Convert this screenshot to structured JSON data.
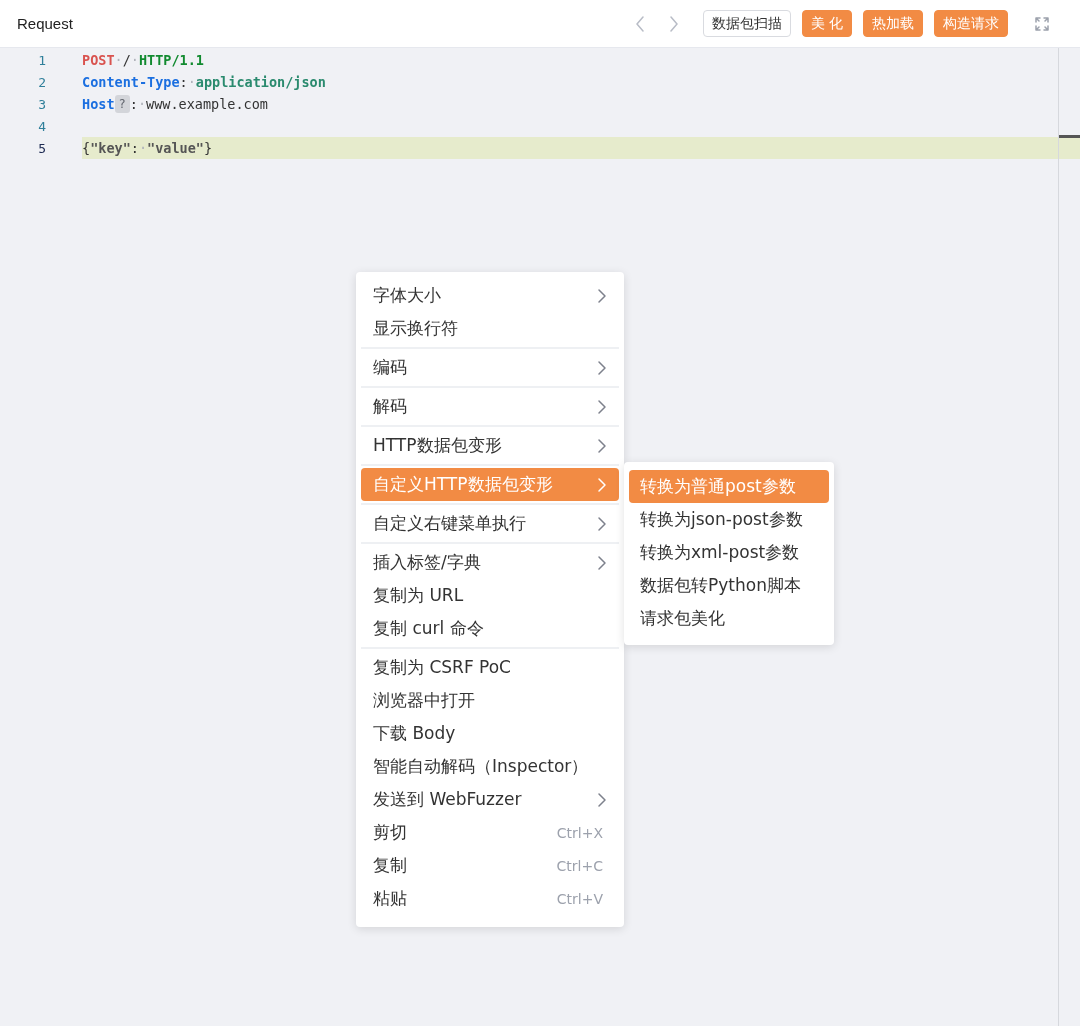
{
  "header": {
    "title": "Request",
    "buttons": [
      {
        "label": "数据包扫描",
        "kind": "outline"
      },
      {
        "label": "美 化",
        "kind": "primary"
      },
      {
        "label": "热加载",
        "kind": "primary"
      },
      {
        "label": "构造请求",
        "kind": "primary"
      }
    ]
  },
  "editor": {
    "lines": [
      {
        "number": "1",
        "active": false,
        "tokens": [
          {
            "kind": "method",
            "text": "POST"
          },
          {
            "kind": "space",
            "text": "·"
          },
          {
            "kind": "plain",
            "text": "/"
          },
          {
            "kind": "space",
            "text": "·"
          },
          {
            "kind": "version",
            "text": "HTTP/1.1"
          }
        ]
      },
      {
        "number": "2",
        "active": false,
        "tokens": [
          {
            "kind": "key",
            "text": "Content-Type"
          },
          {
            "kind": "plain",
            "text": ":"
          },
          {
            "kind": "space",
            "text": "·"
          },
          {
            "kind": "value",
            "text": "application/json"
          }
        ]
      },
      {
        "number": "3",
        "active": false,
        "tokens": [
          {
            "kind": "key",
            "text": "Host"
          },
          {
            "kind": "hint",
            "text": "?"
          },
          {
            "kind": "plain",
            "text": ":"
          },
          {
            "kind": "space",
            "text": "·"
          },
          {
            "kind": "plain",
            "text": "www.example.com"
          }
        ]
      },
      {
        "number": "4",
        "active": false
      },
      {
        "number": "5",
        "active": true,
        "tokens": [
          {
            "kind": "plain",
            "text": "{"
          },
          {
            "kind": "string",
            "text": "\"key\""
          },
          {
            "kind": "plain",
            "text": ":"
          },
          {
            "kind": "space",
            "text": "·"
          },
          {
            "kind": "string",
            "text": "\"value\""
          },
          {
            "kind": "plain",
            "text": "}"
          }
        ]
      }
    ]
  },
  "context_menu": {
    "groups": [
      [
        {
          "label": "字体大小",
          "submenu": true,
          "selected": false
        },
        {
          "label": "显示换行符",
          "submenu": false,
          "selected": false
        }
      ],
      [
        {
          "label": "编码",
          "submenu": true,
          "selected": false
        }
      ],
      [
        {
          "label": "解码",
          "submenu": true,
          "selected": false
        }
      ],
      [
        {
          "label": "HTTP数据包变形",
          "submenu": true,
          "selected": false
        }
      ],
      [
        {
          "label": "自定义HTTP数据包变形",
          "submenu": true,
          "selected": true
        }
      ],
      [
        {
          "label": "自定义右键菜单执行",
          "submenu": true,
          "selected": false
        }
      ],
      [
        {
          "label": "插入标签/字典",
          "submenu": true,
          "selected": false
        },
        {
          "label": "复制为 URL",
          "submenu": false,
          "selected": false
        },
        {
          "label": "复制 curl 命令",
          "submenu": false,
          "selected": false
        }
      ],
      [
        {
          "label": "复制为 CSRF PoC",
          "submenu": false,
          "selected": false
        },
        {
          "label": "浏览器中打开",
          "submenu": false,
          "selected": false
        },
        {
          "label": "下载 Body",
          "submenu": false,
          "selected": false
        },
        {
          "label": "智能自动解码（Inspector）",
          "submenu": false,
          "selected": false
        },
        {
          "label": "发送到 WebFuzzer",
          "submenu": true,
          "selected": false
        },
        {
          "label": "剪切",
          "submenu": false,
          "selected": false,
          "shortcut": "Ctrl+X"
        },
        {
          "label": "复制",
          "submenu": false,
          "selected": false,
          "shortcut": "Ctrl+C"
        },
        {
          "label": "粘贴",
          "submenu": false,
          "selected": false,
          "shortcut": "Ctrl+V"
        }
      ]
    ]
  },
  "submenu": {
    "items": [
      {
        "label": "转换为普通post参数",
        "selected": true
      },
      {
        "label": "转换为json-post参数",
        "selected": false
      },
      {
        "label": "转换为xml-post参数",
        "selected": false
      },
      {
        "label": "数据包转Python脚本",
        "selected": false
      },
      {
        "label": "请求包美化",
        "selected": false
      }
    ]
  }
}
